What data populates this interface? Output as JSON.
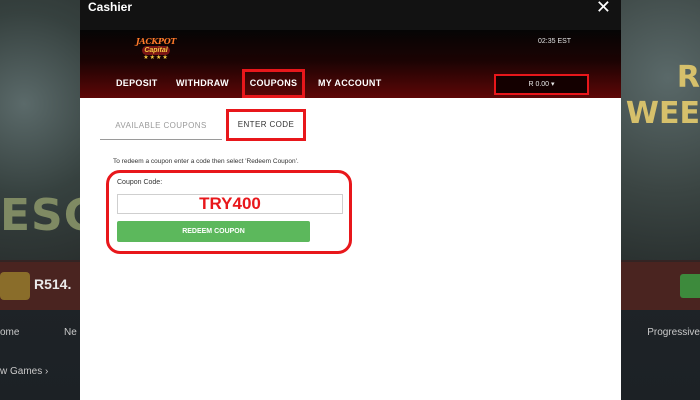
{
  "window": {
    "title": "Cashier",
    "close_icon": "close-icon"
  },
  "brand": {
    "logo_line1": "JACKPOT",
    "logo_line2": "Capital",
    "logo_stars": "★★★★"
  },
  "header": {
    "time": "02:35 EST",
    "balance": "R 0.00 ▾"
  },
  "tabs": [
    {
      "label": "DEPOSIT",
      "active": false
    },
    {
      "label": "WITHDRAW",
      "active": false
    },
    {
      "label": "COUPONS",
      "active": true
    },
    {
      "label": "MY ACCOUNT",
      "active": false
    }
  ],
  "subtabs": [
    {
      "label": "AVAILABLE COUPONS",
      "active": false
    },
    {
      "label": "ENTER CODE",
      "active": true
    }
  ],
  "form": {
    "instructions": "To redeem a coupon enter a code then select 'Redeem Coupon'.",
    "coupon_label": "Coupon Code:",
    "coupon_value": "TRY400",
    "redeem_label": "REDEEM COUPON"
  },
  "background": {
    "balance": "R514.",
    "left_art_text": "ESC",
    "right_art_text": "R\nWEE",
    "nav_home": "ome",
    "nav_new": "Ne",
    "nav_progressive": "Progressive",
    "new_games": "w Games ›"
  },
  "colors": {
    "highlight": "#e8171b",
    "button_green": "#5cb85c",
    "header_red": "#5e0707"
  }
}
